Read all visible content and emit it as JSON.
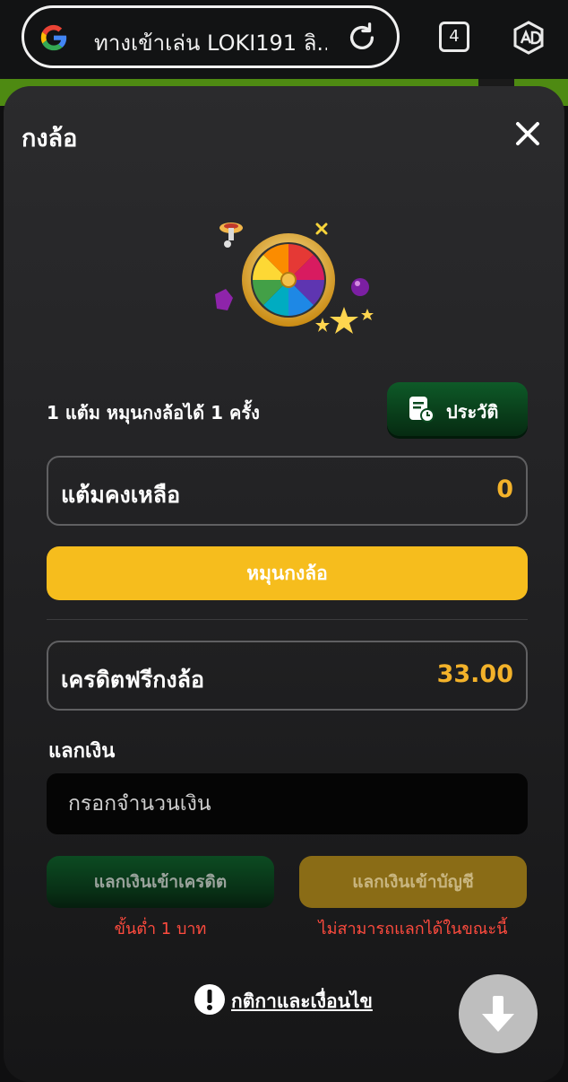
{
  "browser": {
    "url_text": "ทางเข้าเล่น LOKI191 ลิ...",
    "tab_count": "4",
    "icons": [
      "google-icon",
      "reload-icon",
      "adblock-icon"
    ]
  },
  "sheet": {
    "title": "กงล้อ",
    "info_text": "1 แต้ม หมุนกงล้อได้ 1 ครั้ง",
    "history_label": "ประวัติ",
    "points_label": "แต้มคงเหลือ",
    "points_value": "0",
    "spin_label": "หมุนกงล้อ",
    "credit_label": "เครดิตฟรีกงล้อ",
    "credit_value": "33.00",
    "exchange_label": "แลกเงิน",
    "amount_placeholder": "กรอกจำนวนเงิน",
    "exchange_credit_label": "แลกเงินเข้าเครดิต",
    "exchange_bank_label": "แลกเงินเข้าบัญชี",
    "min_note": "ขั้นต่ำ 1 บาท",
    "unavailable_note": "ไม่สามารถแลกได้ในขณะนี้",
    "terms_label": "กติกาและเงื่อนไข"
  },
  "colors": {
    "accent_yellow": "#f6bd1d",
    "value_gold": "#f3b22a",
    "green_button": "#0e5a28",
    "error_red": "#ff4b3e"
  }
}
